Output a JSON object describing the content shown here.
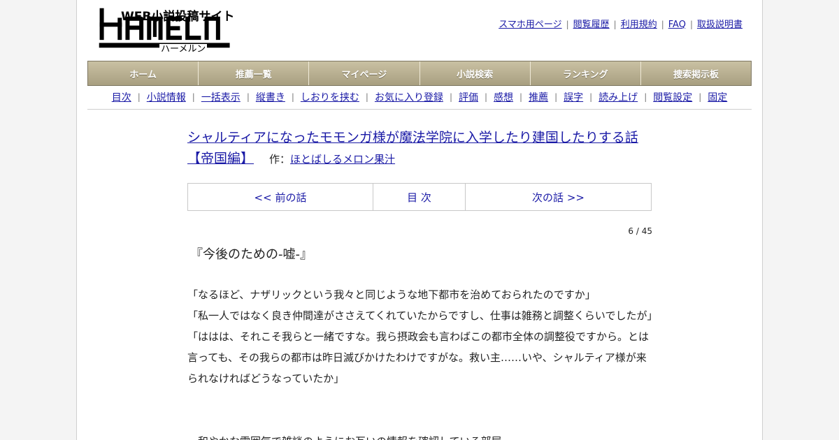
{
  "logo": {
    "word": "HAMELN",
    "tagline": "WEB小説投稿サイト",
    "kana": "ハーメルン"
  },
  "header_links": [
    "スマホ用ページ",
    "閲覧履歴",
    "利用規約",
    "FAQ",
    "取扱説明書"
  ],
  "main_nav": [
    "ホーム",
    "推薦一覧",
    "マイページ",
    "小説検索",
    "ランキング",
    "捜索掲示板"
  ],
  "sub_nav": [
    "目次",
    "小説情報",
    "一括表示",
    "縦書き",
    "しおりを挟む",
    "お気に入り登録",
    "評価",
    "感想",
    "推薦",
    "誤字",
    "読み上げ",
    "閲覧設定",
    "固定"
  ],
  "novel": {
    "title": "シャルティアになったモモンガ様が魔法学院に入学したり建国したりする話【帝国編】",
    "author_label": "作：",
    "author": "ほとばしるメロン果汁"
  },
  "episode_nav": {
    "prev": "<< 前の話",
    "toc": "目 次",
    "next": "次の話 >>"
  },
  "chapter": {
    "count": "6 / 45",
    "title": "『今後のための-嘘-』",
    "paragraphs": [
      "「なるほど、ナザリックという我々と同じような地下都市を治めておられたのですか」",
      "「私一人ではなく良き仲間達がささえてくれていたからですし、仕事は雑務と調整くらいでしたが」",
      "「ははは、それこそ我らと一緒ですな。我ら摂政会も言わばこの都市全体の調整役ですから。とは言っても、その我らの都市は昨日滅びかけたわけですがな。救い主……いや、シャルティア様が来られなければどうなっていたか」",
      "",
      "　和やかな雰囲気で雑談のようにお互いの情報を確認している部屋"
    ]
  }
}
